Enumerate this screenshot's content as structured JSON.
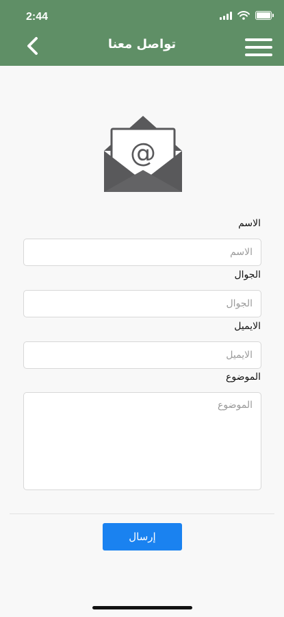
{
  "status_bar": {
    "time": "2:44",
    "icons": [
      "signal-icon",
      "wifi-icon",
      "battery-icon"
    ]
  },
  "header": {
    "title": "تواصل معنا",
    "back_icon": "chevron-left-icon",
    "menu_icon": "hamburger-menu-icon",
    "background_color": "#5f8f66"
  },
  "hero": {
    "icon": "envelope-at-icon"
  },
  "form": {
    "name": {
      "label": "الاسم",
      "placeholder": "الاسم",
      "value": ""
    },
    "mobile": {
      "label": "الجوال",
      "placeholder": "الجوال",
      "value": ""
    },
    "email": {
      "label": "الايميل",
      "placeholder": "الايميل",
      "value": ""
    },
    "subject": {
      "label": "الموضوع",
      "placeholder": "الموضوع",
      "value": ""
    },
    "submit_label": "إرسال",
    "submit_color": "#1a82f0"
  }
}
